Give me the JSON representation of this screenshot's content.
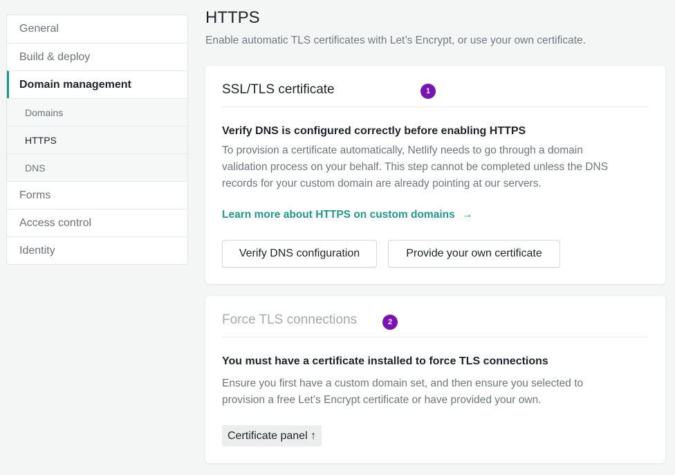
{
  "sidebar": {
    "items": [
      {
        "label": "General"
      },
      {
        "label": "Build & deploy"
      },
      {
        "label": "Domain management"
      },
      {
        "label": "Domains"
      },
      {
        "label": "HTTPS"
      },
      {
        "label": "DNS"
      },
      {
        "label": "Forms"
      },
      {
        "label": "Access control"
      },
      {
        "label": "Identity"
      }
    ]
  },
  "page": {
    "title": "HTTPS",
    "subtitle": "Enable automatic TLS certificates with Let’s Encrypt, or use your own certificate."
  },
  "ssl_card": {
    "title": "SSL/TLS certificate",
    "badge": "1",
    "heading": "Verify DNS is configured correctly before enabling HTTPS",
    "text_lines": [
      "To provision a certificate automatically, Netlify needs to go through a domain",
      "validation process on your behalf. This step cannot be completed unless the DNS",
      "records for your custom domain are already pointing at our servers."
    ],
    "learn_link": "Learn more about HTTPS on custom domains",
    "learn_arrow": "→",
    "verify_button": "Verify DNS configuration",
    "own_cert_button": "Provide your own certificate"
  },
  "tls_card": {
    "title": "Force TLS connections",
    "badge": "2",
    "heading": "You must have a certificate installed to force TLS connections",
    "text_lines": [
      "Ensure you first have a custom domain set, and then ensure you selected to",
      "provision a free Let’s Encrypt certificate or have provided your own."
    ],
    "cert_panel_button": "Certificate panel",
    "cert_panel_arrow": "↑"
  },
  "colors": {
    "accent": "#19998b",
    "link": "#1e9b8c",
    "badge": "#7a12b8",
    "background": "#f4f6f6"
  }
}
